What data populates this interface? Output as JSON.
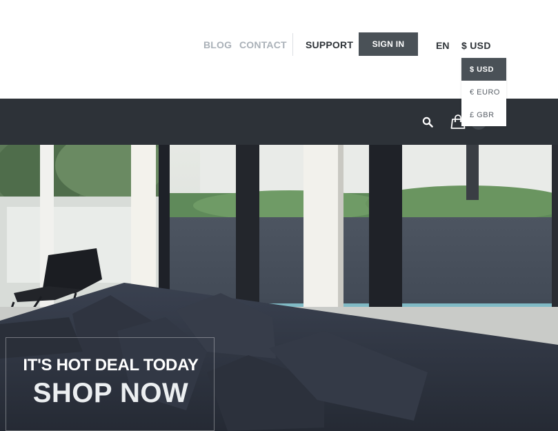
{
  "header": {
    "links": [
      {
        "label": "BLOG"
      },
      {
        "label": "CONTACT"
      },
      {
        "label": "SUPPORT"
      }
    ],
    "signin_label": "SIGN IN",
    "language": "EN",
    "currency_current": "$ USD",
    "currency_options": [
      {
        "label": "$ USD",
        "selected": true
      },
      {
        "label": "€ EURO",
        "selected": false
      },
      {
        "label": "£ GBR",
        "selected": false
      }
    ]
  },
  "nav": {
    "icons": [
      "search-icon",
      "shopping-bag-icon"
    ]
  },
  "hero": {
    "tagline": "IT'S HOT DEAL TODAY",
    "cta": "SHOP NOW"
  },
  "colors": {
    "dark_nav": "#2d3238",
    "signin_bg": "#4a5157",
    "muted_link": "#aab1b8"
  }
}
